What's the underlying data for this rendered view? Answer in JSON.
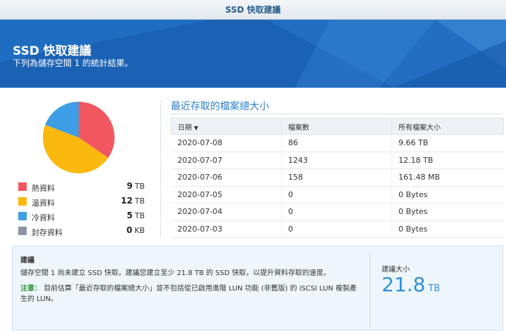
{
  "window": {
    "title": "SSD 快取建議"
  },
  "banner": {
    "title": "SSD 快取建議",
    "subtitle": "下列為儲存空間 1 的統計結果。"
  },
  "usage": {
    "items": [
      {
        "label": "熱資料",
        "value": "9",
        "unit": "TB",
        "color": "#f2575f"
      },
      {
        "label": "溫資料",
        "value": "12",
        "unit": "TB",
        "color": "#fbb80f"
      },
      {
        "label": "冷資料",
        "value": "5",
        "unit": "TB",
        "color": "#3d9ee6"
      },
      {
        "label": "封存資料",
        "value": "0",
        "unit": "KB",
        "color": "#8a96a3"
      }
    ]
  },
  "recent": {
    "title": "最近存取的檔案總大小",
    "columns": [
      "日期",
      "檔案數",
      "所有檔案大小"
    ],
    "rows": [
      [
        "2020-07-08",
        "86",
        "9.66 TB"
      ],
      [
        "2020-07-07",
        "1243",
        "12.18 TB"
      ],
      [
        "2020-07-06",
        "158",
        "161.48 MB"
      ],
      [
        "2020-07-05",
        "0",
        "0 Bytes"
      ],
      [
        "2020-07-04",
        "0",
        "0 Bytes"
      ],
      [
        "2020-07-03",
        "0",
        "0 Bytes"
      ]
    ]
  },
  "advice": {
    "title": "建議",
    "text": "儲存空間 1 尚未建立 SSD 快取。建議您建立至少 21.8 TB 的 SSD 快取，以提升資料存取的速度。",
    "note_label": "注意：",
    "note": "目前估算「最近存取的檔案總大小」並不包括從已啟用進階 LUN 功能 (非舊版) 的 iSCSI LUN 複製產生的 LUN。",
    "size_label": "建議大小",
    "size_value": "21.8",
    "size_unit": "TB"
  }
}
